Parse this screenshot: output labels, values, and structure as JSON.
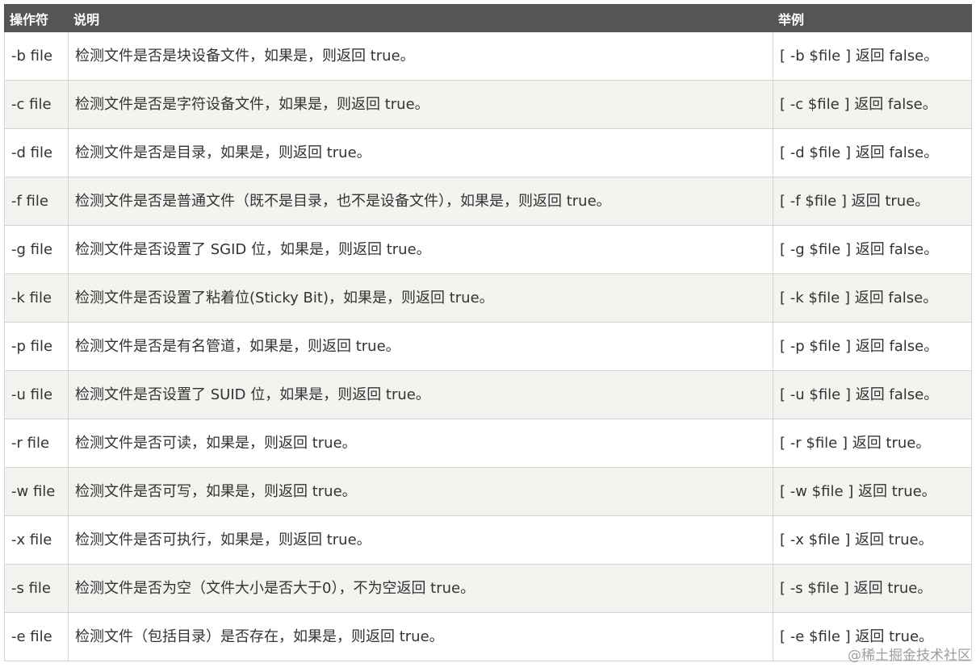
{
  "table": {
    "headers": [
      "操作符",
      "说明",
      "举例"
    ],
    "rows": [
      [
        "-b file",
        "检测文件是否是块设备文件，如果是，则返回 true。",
        "[ -b $file ] 返回 false。"
      ],
      [
        "-c file",
        "检测文件是否是字符设备文件，如果是，则返回 true。",
        "[ -c $file ] 返回 false。"
      ],
      [
        "-d file",
        "检测文件是否是目录，如果是，则返回 true。",
        "[ -d $file ] 返回 false。"
      ],
      [
        "-f file",
        "检测文件是否是普通文件（既不是目录，也不是设备文件），如果是，则返回 true。",
        "[ -f $file ] 返回 true。"
      ],
      [
        "-g file",
        "检测文件是否设置了 SGID 位，如果是，则返回 true。",
        "[ -g $file ] 返回 false。"
      ],
      [
        "-k file",
        "检测文件是否设置了粘着位(Sticky Bit)，如果是，则返回 true。",
        "[ -k $file ] 返回 false。"
      ],
      [
        "-p file",
        "检测文件是否是有名管道，如果是，则返回 true。",
        "[ -p $file ] 返回 false。"
      ],
      [
        "-u file",
        "检测文件是否设置了 SUID 位，如果是，则返回 true。",
        "[ -u $file ] 返回 false。"
      ],
      [
        "-r file",
        "检测文件是否可读，如果是，则返回 true。",
        "[ -r $file ] 返回 true。"
      ],
      [
        "-w file",
        "检测文件是否可写，如果是，则返回 true。",
        "[ -w $file ] 返回 true。"
      ],
      [
        "-x file",
        "检测文件是否可执行，如果是，则返回 true。",
        "[ -x $file ] 返回 true。"
      ],
      [
        "-s file",
        "检测文件是否为空（文件大小是否大于0），不为空返回 true。",
        "[ -s $file ] 返回 true。"
      ],
      [
        "-e file",
        "检测文件（包括目录）是否存在，如果是，则返回 true。",
        "[ -e $file ] 返回 true。"
      ]
    ]
  },
  "watermark": "@稀土掘金技术社区"
}
